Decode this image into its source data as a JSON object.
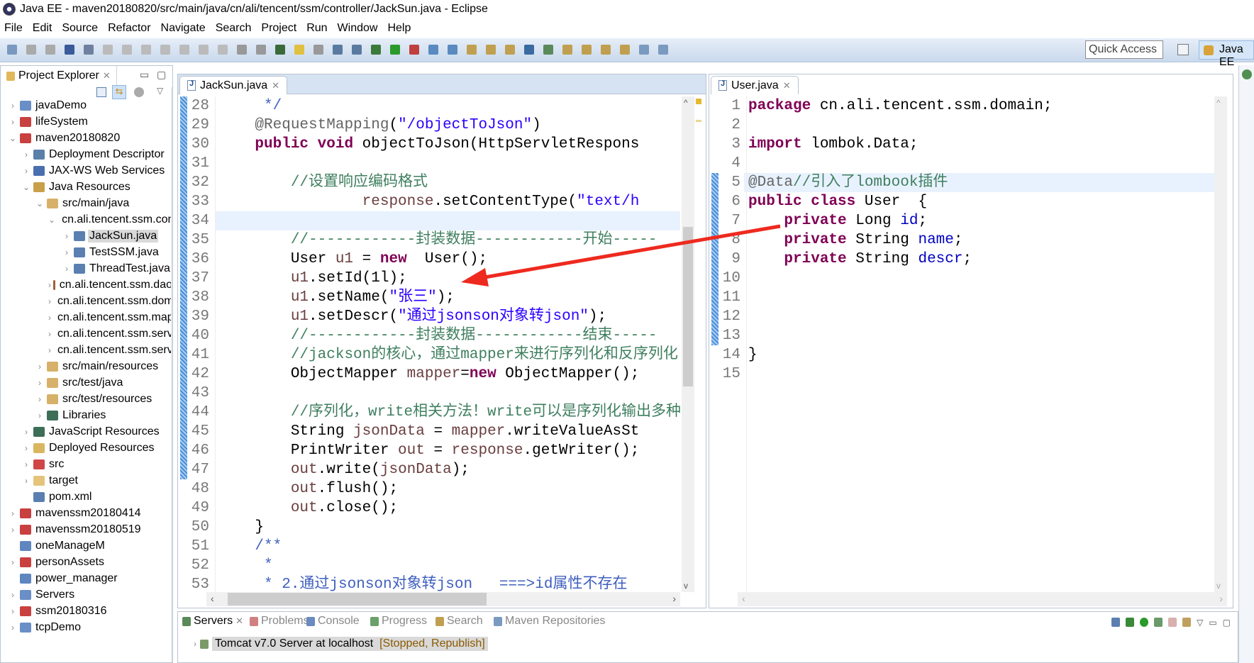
{
  "window": {
    "title": "Java EE - maven20180820/src/main/java/cn/ali/tencent/ssm/controller/JackSun.java - Eclipse"
  },
  "menu": [
    "File",
    "Edit",
    "Source",
    "Refactor",
    "Navigate",
    "Search",
    "Project",
    "Run",
    "Window",
    "Help"
  ],
  "toolbar": {
    "quick_access": "Quick Access",
    "perspective": "Java EE"
  },
  "explorer": {
    "title": "Project Explorer",
    "items": [
      {
        "level": 0,
        "arrow": ">",
        "label": "javaDemo",
        "icon": "project-icon",
        "color": "#6a8fc7"
      },
      {
        "level": 0,
        "arrow": ">",
        "label": "lifeSystem",
        "icon": "maven-project-icon",
        "color": "#c94040"
      },
      {
        "level": 0,
        "arrow": "v",
        "label": "maven20180820",
        "icon": "maven-project-icon",
        "color": "#c94040"
      },
      {
        "level": 1,
        "arrow": ">",
        "label": "Deployment Descriptor",
        "icon": "descriptor-icon",
        "color": "#5a7fa8"
      },
      {
        "level": 1,
        "arrow": ">",
        "label": "JAX-WS Web Services",
        "icon": "webservice-icon",
        "color": "#4a6fb0"
      },
      {
        "level": 1,
        "arrow": "v",
        "label": "Java Resources",
        "icon": "java-resources-icon",
        "color": "#c9a04a"
      },
      {
        "level": 2,
        "arrow": "v",
        "label": "src/main/java",
        "icon": "source-folder-icon",
        "color": "#d7b06a"
      },
      {
        "level": 3,
        "arrow": "v",
        "label": "cn.ali.tencent.ssm.controller",
        "icon": "package-icon",
        "color": "#a0603a"
      },
      {
        "level": 4,
        "arrow": ">",
        "label": "JackSun.java",
        "icon": "java-file-icon",
        "color": "#5a7fb0",
        "selected": true
      },
      {
        "level": 4,
        "arrow": ">",
        "label": "TestSSM.java",
        "icon": "java-file-icon",
        "color": "#5a7fb0"
      },
      {
        "level": 4,
        "arrow": ">",
        "label": "ThreadTest.java",
        "icon": "java-file-icon",
        "color": "#5a7fb0"
      },
      {
        "level": 3,
        "arrow": ">",
        "label": "cn.ali.tencent.ssm.dao",
        "icon": "package-icon",
        "color": "#a0603a"
      },
      {
        "level": 3,
        "arrow": ">",
        "label": "cn.ali.tencent.ssm.domain",
        "icon": "package-icon",
        "color": "#a0603a"
      },
      {
        "level": 3,
        "arrow": ">",
        "label": "cn.ali.tencent.ssm.mapper",
        "icon": "package-icon",
        "color": "#a0603a"
      },
      {
        "level": 3,
        "arrow": ">",
        "label": "cn.ali.tencent.ssm.service",
        "icon": "package-icon",
        "color": "#a0603a"
      },
      {
        "level": 3,
        "arrow": ">",
        "label": "cn.ali.tencent.ssm.service",
        "icon": "package-icon",
        "color": "#a0603a"
      },
      {
        "level": 2,
        "arrow": ">",
        "label": "src/main/resources",
        "icon": "source-folder-icon",
        "color": "#d7b06a"
      },
      {
        "level": 2,
        "arrow": ">",
        "label": "src/test/java",
        "icon": "source-folder-icon",
        "color": "#d7b06a"
      },
      {
        "level": 2,
        "arrow": ">",
        "label": "src/test/resources",
        "icon": "source-folder-icon",
        "color": "#d7b06a"
      },
      {
        "level": 2,
        "arrow": ">",
        "label": "Libraries",
        "icon": "libraries-icon",
        "color": "#3d6e58"
      },
      {
        "level": 1,
        "arrow": ">",
        "label": "JavaScript Resources",
        "icon": "libraries-icon",
        "color": "#3d6e58"
      },
      {
        "level": 1,
        "arrow": ">",
        "label": "Deployed Resources",
        "icon": "deployed-icon",
        "color": "#d9b760"
      },
      {
        "level": 1,
        "arrow": ">",
        "label": "src",
        "icon": "folder-error-icon",
        "color": "#d04545"
      },
      {
        "level": 1,
        "arrow": ">",
        "label": "target",
        "icon": "folder-icon",
        "color": "#e5c47a"
      },
      {
        "level": 1,
        "arrow": "",
        "label": "pom.xml",
        "icon": "xml-file-icon",
        "color": "#5a7fb0"
      },
      {
        "level": 0,
        "arrow": ">",
        "label": "mavenssm20180414",
        "icon": "maven-project-icon",
        "color": "#c94040"
      },
      {
        "level": 0,
        "arrow": ">",
        "label": "mavenssm20180519",
        "icon": "maven-project-icon",
        "color": "#c94040"
      },
      {
        "level": 0,
        "arrow": "",
        "label": "oneManageM",
        "icon": "closed-project-icon",
        "color": "#5f86bf"
      },
      {
        "level": 0,
        "arrow": ">",
        "label": "personAssets",
        "icon": "maven-project-icon",
        "color": "#c94040"
      },
      {
        "level": 0,
        "arrow": "",
        "label": "power_manager",
        "icon": "closed-project-icon",
        "color": "#5f86bf"
      },
      {
        "level": 0,
        "arrow": ">",
        "label": "Servers",
        "icon": "folder-icon",
        "color": "#6a8fc7"
      },
      {
        "level": 0,
        "arrow": ">",
        "label": "ssm20180316",
        "icon": "web-project-icon",
        "color": "#c94040"
      },
      {
        "level": 0,
        "arrow": ">",
        "label": "tcpDemo",
        "icon": "project-icon",
        "color": "#6a8fc7"
      }
    ]
  },
  "editor_left": {
    "tab": "JackSun.java",
    "first_line": 28,
    "current_line": 34,
    "lines": [
      [
        [
          "     ",
          ""
        ],
        [
          "*/",
          "doc"
        ]
      ],
      [
        [
          "    ",
          ""
        ],
        [
          "@RequestMapping",
          "ann"
        ],
        [
          "(",
          ""
        ],
        [
          "\"/objectToJson\"",
          "str"
        ],
        [
          ")",
          ""
        ]
      ],
      [
        [
          "    ",
          ""
        ],
        [
          "public",
          "kw"
        ],
        [
          " ",
          ""
        ],
        [
          "void",
          "kw"
        ],
        [
          " objectToJson(HttpServletRespons",
          ""
        ]
      ],
      [],
      [
        [
          "        ",
          ""
        ],
        [
          "//设置响应编码格式",
          "cm"
        ]
      ],
      [
        [
          "                ",
          ""
        ],
        [
          "response",
          "var"
        ],
        [
          ".setContentType(",
          ""
        ],
        [
          "\"text/h",
          "str"
        ]
      ],
      [],
      [
        [
          "        ",
          ""
        ],
        [
          "//------------封装数据------------开始-----",
          "cm"
        ]
      ],
      [
        [
          "        User ",
          ""
        ],
        [
          "u1",
          "var"
        ],
        [
          " = ",
          ""
        ],
        [
          "new",
          "kw"
        ],
        [
          "  User();",
          ""
        ]
      ],
      [
        [
          "        ",
          ""
        ],
        [
          "u1",
          "var"
        ],
        [
          ".setId(1l);",
          ""
        ]
      ],
      [
        [
          "        ",
          ""
        ],
        [
          "u1",
          "var"
        ],
        [
          ".setName(",
          ""
        ],
        [
          "\"张三\"",
          "str"
        ],
        [
          ");",
          ""
        ]
      ],
      [
        [
          "        ",
          ""
        ],
        [
          "u1",
          "var"
        ],
        [
          ".setDescr(",
          ""
        ],
        [
          "\"通过jsonson对象转json\"",
          "str"
        ],
        [
          ");",
          ""
        ]
      ],
      [
        [
          "        ",
          ""
        ],
        [
          "//------------封装数据------------结束-----",
          "cm"
        ]
      ],
      [
        [
          "        ",
          ""
        ],
        [
          "//jackson的核心，通过mapper来进行序列化和反序列化",
          "cm"
        ]
      ],
      [
        [
          "        ObjectMapper ",
          ""
        ],
        [
          "mapper",
          "var"
        ],
        [
          "=",
          ""
        ],
        [
          "new",
          "kw"
        ],
        [
          " ObjectMapper();",
          ""
        ]
      ],
      [],
      [
        [
          "        ",
          ""
        ],
        [
          "//序列化，write相关方法！write可以是序列化输出多种格",
          "cm"
        ]
      ],
      [
        [
          "        String ",
          ""
        ],
        [
          "jsonData",
          "var"
        ],
        [
          " = ",
          ""
        ],
        [
          "mapper",
          "var"
        ],
        [
          ".writeValueAsSt",
          ""
        ]
      ],
      [
        [
          "        PrintWriter ",
          ""
        ],
        [
          "out",
          "var"
        ],
        [
          " = ",
          ""
        ],
        [
          "response",
          "var"
        ],
        [
          ".getWriter();",
          ""
        ]
      ],
      [
        [
          "        ",
          ""
        ],
        [
          "out",
          "var"
        ],
        [
          ".write(",
          ""
        ],
        [
          "jsonData",
          "var"
        ],
        [
          ");",
          ""
        ]
      ],
      [
        [
          "        ",
          ""
        ],
        [
          "out",
          "var"
        ],
        [
          ".flush();",
          ""
        ]
      ],
      [
        [
          "        ",
          ""
        ],
        [
          "out",
          "var"
        ],
        [
          ".close();",
          ""
        ]
      ],
      [
        [
          "    }",
          ""
        ]
      ],
      [
        [
          "    ",
          ""
        ],
        [
          "/**",
          "doc"
        ]
      ],
      [
        [
          "     ",
          ""
        ],
        [
          "*",
          "doc"
        ]
      ],
      [
        [
          "     ",
          ""
        ],
        [
          "* 2.通过jsonson对象转json   ===>id属性不存在",
          "doc"
        ]
      ]
    ]
  },
  "editor_right": {
    "tab": "User.java",
    "first_line": 1,
    "current_line": 5,
    "lines": [
      [
        [
          "package",
          "kw"
        ],
        [
          " cn.ali.tencent.ssm.domain;",
          ""
        ]
      ],
      [],
      [
        [
          "import",
          "kw"
        ],
        [
          " lombok.Data;",
          ""
        ]
      ],
      [],
      [
        [
          "@Data",
          "ann"
        ],
        [
          "//引入了lombook插件",
          "cm"
        ]
      ],
      [
        [
          "public",
          "kw"
        ],
        [
          " ",
          ""
        ],
        [
          "class",
          "kw"
        ],
        [
          " User  {",
          ""
        ]
      ],
      [
        [
          "    ",
          ""
        ],
        [
          "private",
          "kw"
        ],
        [
          " Long ",
          ""
        ],
        [
          "id",
          "fld"
        ],
        [
          ";",
          ""
        ]
      ],
      [
        [
          "    ",
          ""
        ],
        [
          "private",
          "kw"
        ],
        [
          " String ",
          ""
        ],
        [
          "name",
          "fld"
        ],
        [
          ";",
          ""
        ]
      ],
      [
        [
          "    ",
          ""
        ],
        [
          "private",
          "kw"
        ],
        [
          " String ",
          ""
        ],
        [
          "descr",
          "fld"
        ],
        [
          ";",
          ""
        ]
      ],
      [],
      [],
      [],
      [],
      [
        [
          "}",
          ""
        ]
      ],
      []
    ]
  },
  "bottom": {
    "tabs": [
      "Servers",
      "Problems",
      "Console",
      "Progress",
      "Search",
      "Maven Repositories"
    ],
    "server": {
      "name": "Tomcat v7.0 Server at localhost",
      "status": "[Stopped, Republish]"
    }
  },
  "colors": {
    "annotation_arrow": "#ee2a1f",
    "keyword": "#7f0055",
    "string": "#2a00ff",
    "comment": "#3f7f5f"
  }
}
